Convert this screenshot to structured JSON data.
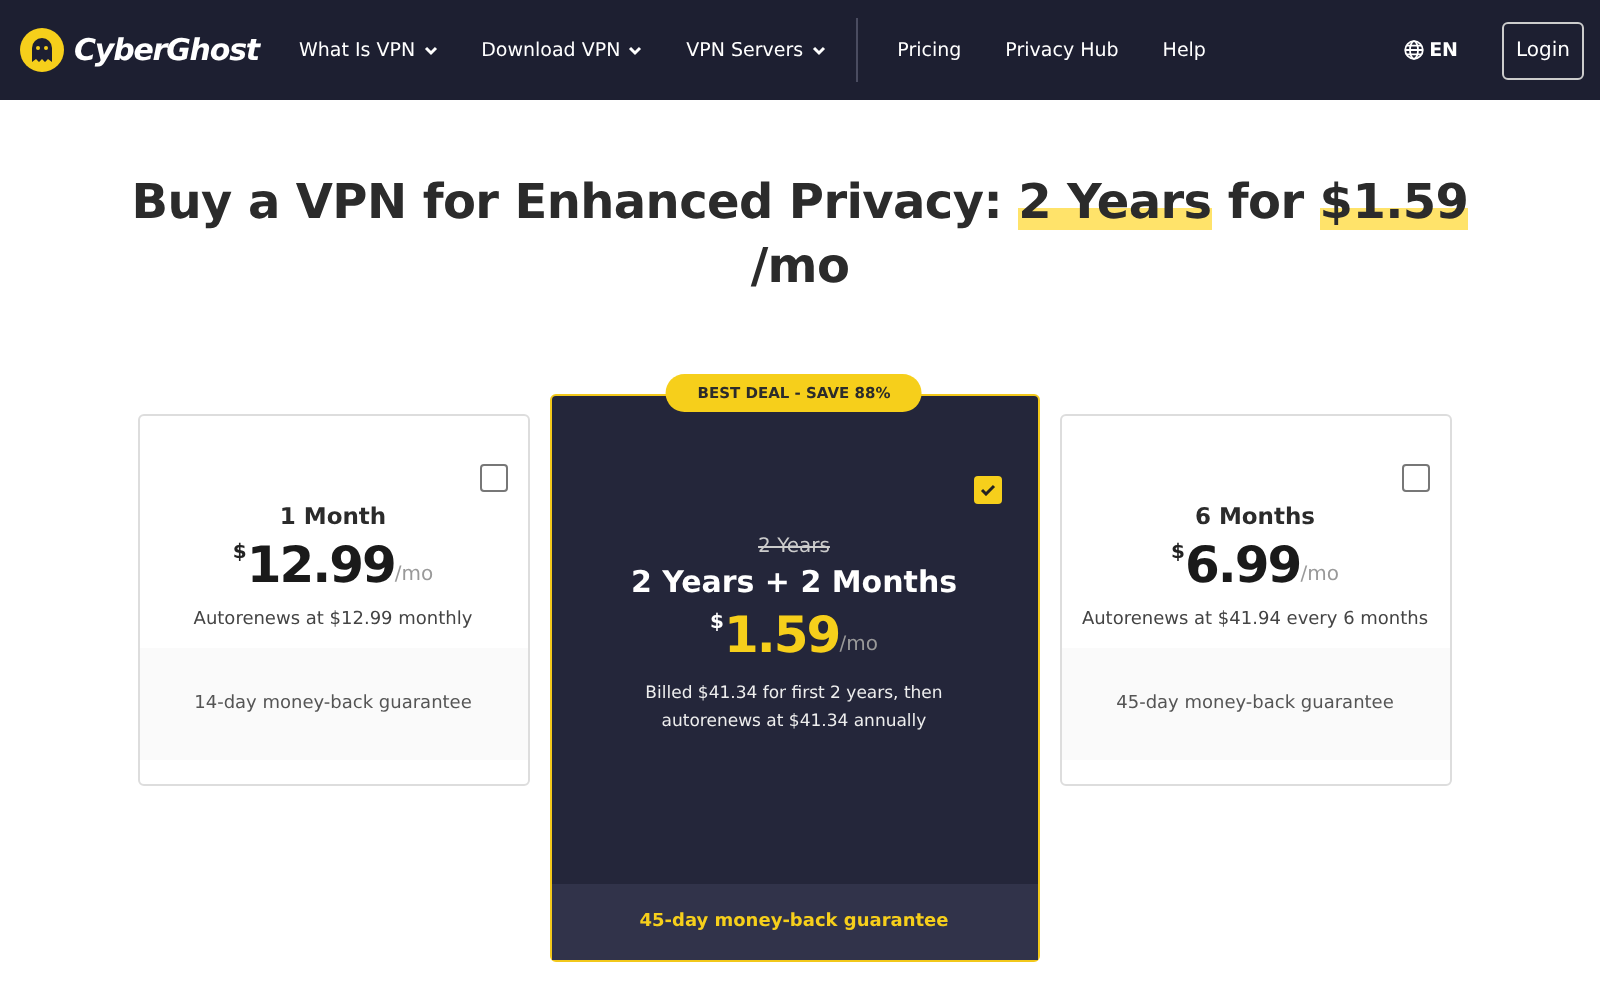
{
  "nav": {
    "brand": "CyberGhost",
    "menus": [
      {
        "label": "What Is VPN"
      },
      {
        "label": "Download VPN"
      },
      {
        "label": "VPN Servers"
      }
    ],
    "links": [
      {
        "label": "Pricing"
      },
      {
        "label": "Privacy Hub"
      },
      {
        "label": "Help"
      }
    ],
    "language": "EN",
    "login": "Login"
  },
  "headline": [
    {
      "text": "Buy a VPN for Enhanced Privacy:",
      "highlighted": false
    },
    {
      "text": "2 Years",
      "highlighted": true
    },
    {
      "text": "for",
      "highlighted": false
    },
    {
      "text": "$1.59",
      "highlighted": true
    },
    {
      "text": "/mo",
      "highlighted": false
    }
  ],
  "plans": [
    {
      "name": "1 Month",
      "currency": "$",
      "price": "12.99",
      "unit": "/mo",
      "note": "Autorenews at $12.99 monthly",
      "guarantee": "14-day money-back guarantee",
      "selected": false
    },
    {
      "badge": "BEST DEAL - SAVE 88%",
      "old_name": "2 Years",
      "name": "2 Years + 2 Months",
      "currency": "$",
      "price": "1.59",
      "unit": "/mo",
      "note": "Billed $41.34 for first 2 years, then autorenews at $41.34 annually",
      "guarantee": "45-day money-back guarantee",
      "selected": true
    },
    {
      "name": "6 Months",
      "currency": "$",
      "price": "6.99",
      "unit": "/mo",
      "note": "Autorenews at $41.94 every 6 months",
      "guarantee": "45-day money-back guarantee",
      "selected": false
    }
  ]
}
